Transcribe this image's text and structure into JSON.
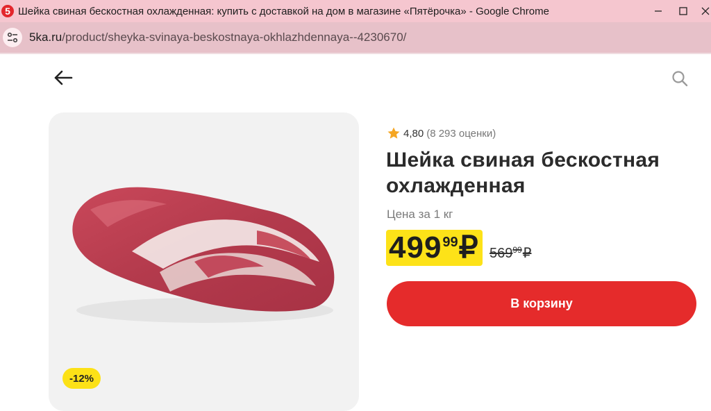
{
  "browser": {
    "favicon_text": "5",
    "window_title": "Шейка свиная бескостная охлажденная: купить с доставкой на дом в магазине «Пятёрочка» - Google Chrome",
    "url_host": "5ka.ru",
    "url_path": "/product/sheyka-svinaya-beskostnaya-okhlazhdennaya--4230670/"
  },
  "product": {
    "rating_value": "4,80",
    "rating_count": "(8 293 оценки)",
    "title": "Шейка свиная бескостная охлажденная",
    "unit_label": "Цена за 1 кг",
    "price_int": "499",
    "price_frac": "99",
    "currency": "₽",
    "old_price_int": "569",
    "old_price_frac": "99",
    "discount": "-12%",
    "cart_button_label": "В корзину"
  },
  "icons": {
    "back": "arrow-left-icon",
    "search": "search-icon",
    "star": "star-icon",
    "site_info": "tune-icon"
  },
  "colors": {
    "accent_yellow": "#fde218",
    "cart_red": "#e52b2b",
    "titlebar_pink": "#f5c6cf"
  }
}
